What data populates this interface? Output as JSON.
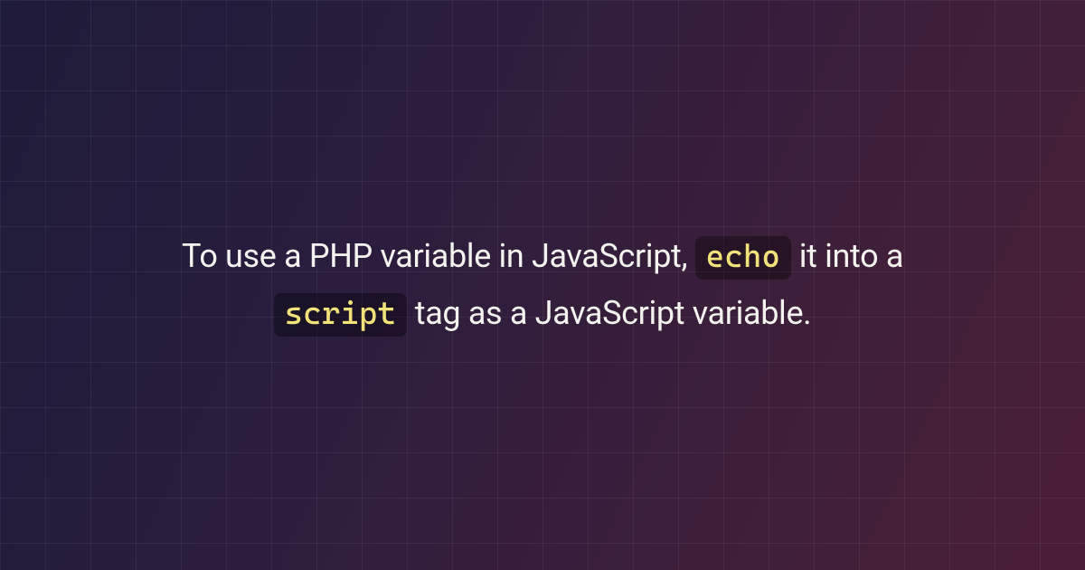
{
  "summary": {
    "part1": "To use a PHP variable in JavaScript, ",
    "code1": "echo",
    "part2": " it into a ",
    "code2": "script",
    "part3": " tag as a JavaScript variable."
  }
}
